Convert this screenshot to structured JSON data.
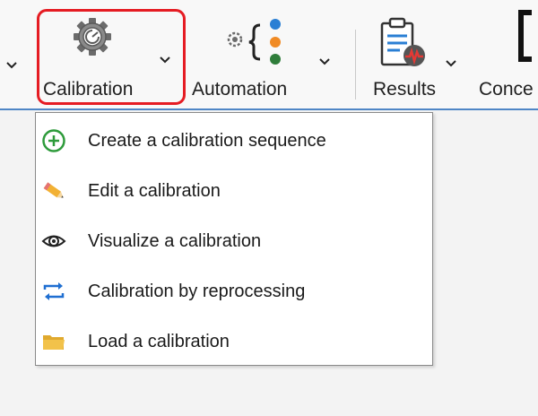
{
  "ribbon": {
    "buttons": [
      {
        "label": "Calibration",
        "icon": "gear-icon"
      },
      {
        "label": "Automation",
        "icon": "automation-icon"
      },
      {
        "label": "Results",
        "icon": "results-clipboard-icon"
      },
      {
        "label": "Conce",
        "icon": "bracket-icon"
      }
    ]
  },
  "menu": {
    "items": [
      {
        "label": "Create a calibration sequence",
        "icon": "plus-circle-icon"
      },
      {
        "label": "Edit a calibration",
        "icon": "pencil-icon"
      },
      {
        "label": "Visualize a calibration",
        "icon": "eye-icon"
      },
      {
        "label": "Calibration by reprocessing",
        "icon": "reprocess-arrows-icon"
      },
      {
        "label": "Load a calibration",
        "icon": "folder-icon"
      }
    ]
  },
  "colors": {
    "highlight": "#e51c23",
    "ribbon_underline": "#4f86c6",
    "plus_green": "#2e9b3b",
    "folder_yellow": "#f2c24a",
    "arrows_blue": "#1f6fd1"
  }
}
